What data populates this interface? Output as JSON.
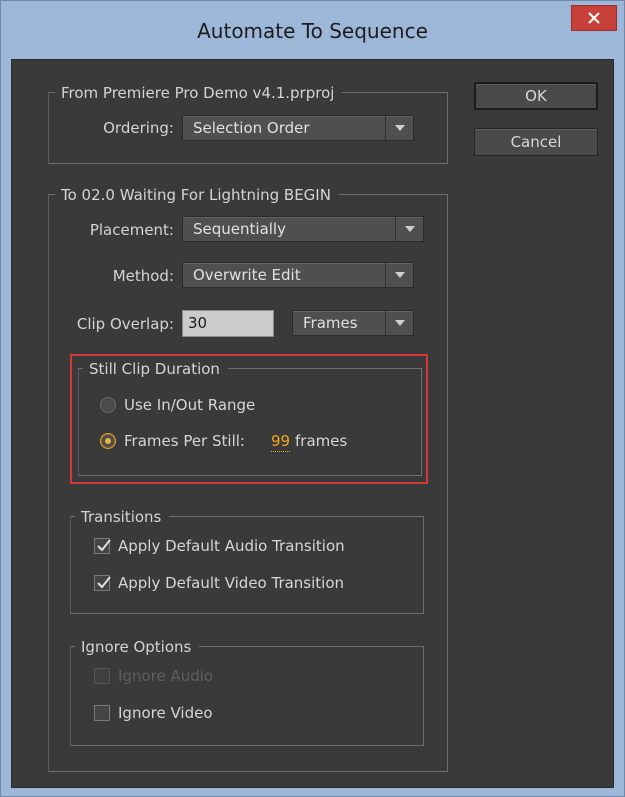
{
  "window": {
    "title": "Automate To Sequence",
    "close_label": "×"
  },
  "buttons": {
    "ok": "OK",
    "cancel": "Cancel"
  },
  "from_group": {
    "title": "From Premiere Pro Demo v4.1.prproj",
    "ordering_label": "Ordering:",
    "ordering_value": "Selection Order"
  },
  "to_group": {
    "title": "To 02.0 Waiting For Lightning BEGIN",
    "placement_label": "Placement:",
    "placement_value": "Sequentially",
    "method_label": "Method:",
    "method_value": "Overwrite Edit",
    "clip_overlap_label": "Clip Overlap:",
    "clip_overlap_value": "30",
    "clip_overlap_unit": "Frames"
  },
  "still_clip": {
    "title": "Still Clip Duration",
    "use_inout_label": "Use In/Out Range",
    "use_inout_checked": false,
    "frames_per_still_label": "Frames Per Still:",
    "frames_per_still_checked": true,
    "frames_value": "99",
    "frames_unit": "frames"
  },
  "transitions": {
    "title": "Transitions",
    "audio_label": "Apply Default Audio Transition",
    "audio_checked": true,
    "video_label": "Apply Default Video Transition",
    "video_checked": true
  },
  "ignore": {
    "title": "Ignore Options",
    "audio_label": "Ignore Audio",
    "audio_checked": false,
    "audio_disabled": true,
    "video_label": "Ignore Video",
    "video_checked": false
  },
  "colors": {
    "dialog_bg": "#3a3a3a",
    "title_bar": "#9db7d9",
    "close_red": "#c8403a",
    "scrub_orange": "#f0a520",
    "highlight_red": "#d43838"
  }
}
